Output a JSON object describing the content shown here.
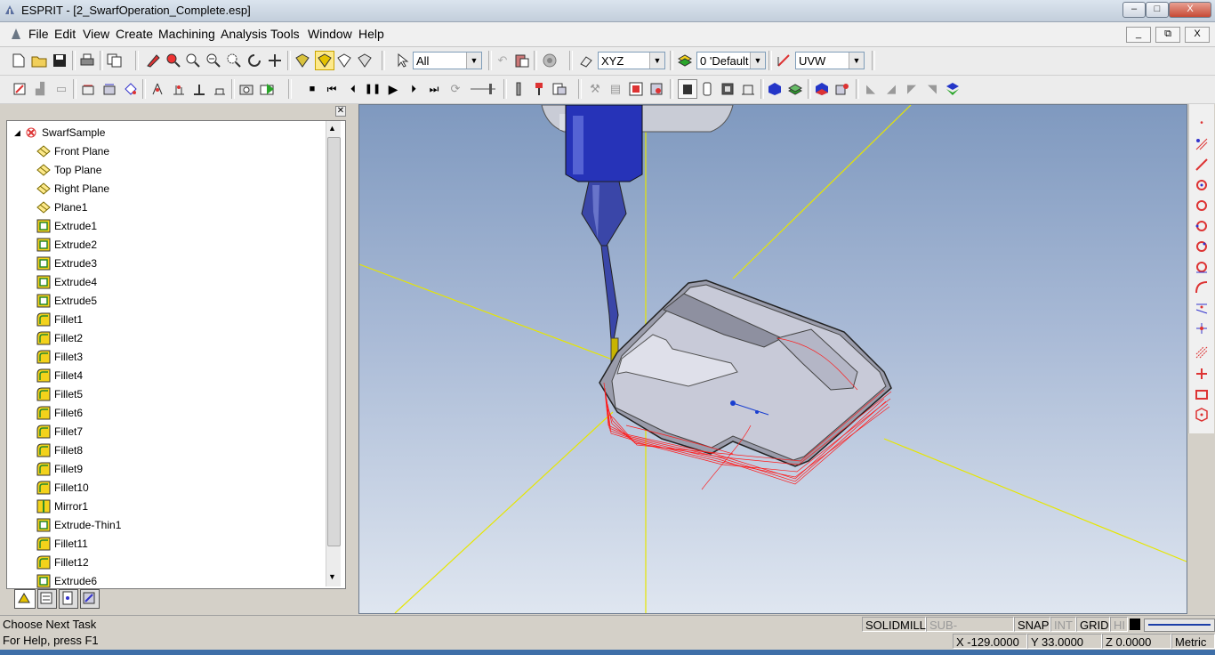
{
  "window": {
    "title": "ESPRIT - [2_SwarfOperation_Complete.esp]",
    "min": "–",
    "max": "□",
    "close": "X"
  },
  "menu": {
    "items": [
      "File",
      "Edit",
      "View",
      "Create",
      "Machining",
      "Analysis",
      "Tools",
      "Window",
      "Help"
    ],
    "mdi_min": "_",
    "mdi_restore": "⧉",
    "mdi_close": "X"
  },
  "toolbar": {
    "selection_filter": "All",
    "work_plane": "XYZ",
    "layer": "0 'Default",
    "coord_system": "UVW"
  },
  "tree": {
    "root": "SwarfSample",
    "items": [
      {
        "label": "Front Plane",
        "type": "plane"
      },
      {
        "label": "Top Plane",
        "type": "plane"
      },
      {
        "label": "Right Plane",
        "type": "plane"
      },
      {
        "label": "Plane1",
        "type": "plane"
      },
      {
        "label": "Extrude1",
        "type": "extrude"
      },
      {
        "label": "Extrude2",
        "type": "extrude"
      },
      {
        "label": "Extrude3",
        "type": "extrude"
      },
      {
        "label": "Extrude4",
        "type": "extrude"
      },
      {
        "label": "Extrude5",
        "type": "extrude"
      },
      {
        "label": "Fillet1",
        "type": "fillet"
      },
      {
        "label": "Fillet2",
        "type": "fillet"
      },
      {
        "label": "Fillet3",
        "type": "fillet"
      },
      {
        "label": "Fillet4",
        "type": "fillet"
      },
      {
        "label": "Fillet5",
        "type": "fillet"
      },
      {
        "label": "Fillet6",
        "type": "fillet"
      },
      {
        "label": "Fillet7",
        "type": "fillet"
      },
      {
        "label": "Fillet8",
        "type": "fillet"
      },
      {
        "label": "Fillet9",
        "type": "fillet"
      },
      {
        "label": "Fillet10",
        "type": "fillet"
      },
      {
        "label": "Mirror1",
        "type": "mirror"
      },
      {
        "label": "Extrude-Thin1",
        "type": "extrude"
      },
      {
        "label": "Fillet11",
        "type": "fillet"
      },
      {
        "label": "Fillet12",
        "type": "fillet"
      },
      {
        "label": "Extrude6",
        "type": "extrude"
      }
    ]
  },
  "status": {
    "message": "Choose Next Task",
    "help": "For Help, press F1",
    "mode": "SOLIDMILL",
    "sub_elements": "SUB-ELEMENTS",
    "snap": "SNAP",
    "int": "INT",
    "grid": "GRID",
    "hi": "HI",
    "x": "X -129.0000",
    "y": "Y 33.0000",
    "z": "Z 0.0000",
    "units": "Metric"
  },
  "colors": {
    "toolpath": "#ff1a1a",
    "axis": "#e6e600",
    "tool_holder": "#2633b8",
    "tool_tip": "#c8b400",
    "part": "#c8cad8"
  }
}
